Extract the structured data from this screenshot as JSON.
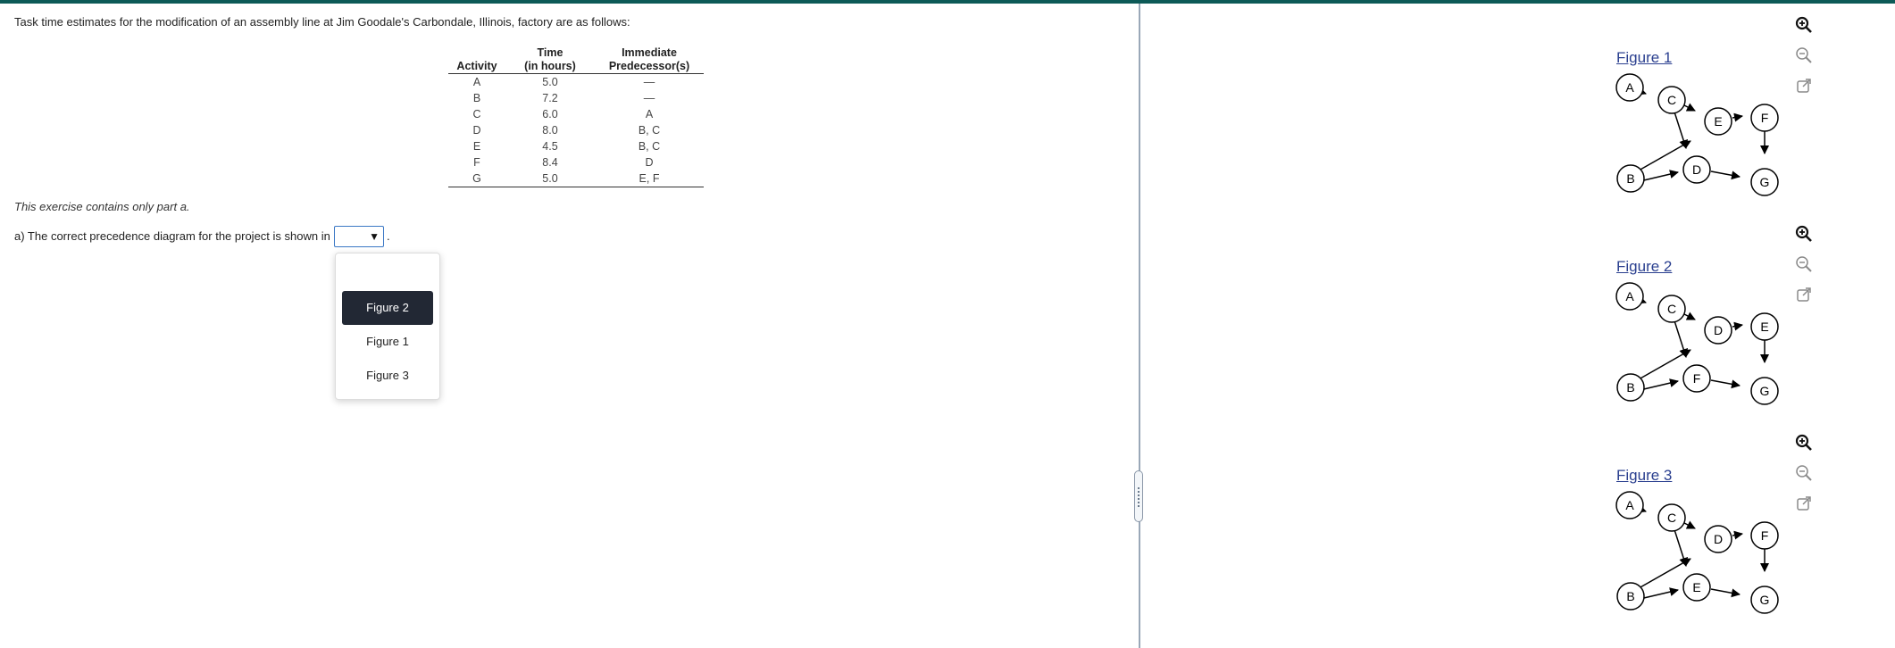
{
  "problem": {
    "prompt": "Task time estimates for the modification of an assembly line at Jim Goodale's Carbondale, Illinois, factory are as follows:",
    "table": {
      "headers": {
        "activity": "Activity",
        "time_line1": "Time",
        "time_line2": "(in hours)",
        "pred_line1": "Immediate",
        "pred_line2": "Predecessor(s)"
      },
      "rows": [
        {
          "activity": "A",
          "time": "5.0",
          "pred": "—"
        },
        {
          "activity": "B",
          "time": "7.2",
          "pred": "—"
        },
        {
          "activity": "C",
          "time": "6.0",
          "pred": "A"
        },
        {
          "activity": "D",
          "time": "8.0",
          "pred": "B, C"
        },
        {
          "activity": "E",
          "time": "4.5",
          "pred": "B, C"
        },
        {
          "activity": "F",
          "time": "8.4",
          "pred": "D"
        },
        {
          "activity": "G",
          "time": "5.0",
          "pred": "E, F"
        }
      ]
    },
    "note": "This exercise contains only part a.",
    "question": "a) The correct precedence diagram for the project is shown in",
    "question_end": ".",
    "select": {
      "value": "",
      "arrow": "▼"
    },
    "dropdown_options": [
      {
        "label": "Figure 2",
        "selected": true
      },
      {
        "label": "Figure 1",
        "selected": false
      },
      {
        "label": "Figure 3",
        "selected": false
      }
    ]
  },
  "figures": [
    {
      "title": "Figure 1",
      "nodes": {
        "n1": "A",
        "n2": "C",
        "n3": "E",
        "n4": "F",
        "n5": "B",
        "n6": "D",
        "n7": "G"
      }
    },
    {
      "title": "Figure 2",
      "nodes": {
        "n1": "A",
        "n2": "C",
        "n3": "D",
        "n4": "E",
        "n5": "B",
        "n6": "F",
        "n7": "G"
      }
    },
    {
      "title": "Figure 3",
      "nodes": {
        "n1": "A",
        "n2": "C",
        "n3": "D",
        "n4": "F",
        "n5": "B",
        "n6": "E",
        "n7": "G"
      }
    }
  ],
  "toolbar_icons": [
    "zoom-in-icon",
    "zoom-out-icon",
    "open-new-window-icon"
  ],
  "colors": {
    "topbar": "#0d5a57",
    "figure_link": "#2a3f8f",
    "selected_option_bg": "#222834",
    "select_border": "#3b78c5"
  }
}
